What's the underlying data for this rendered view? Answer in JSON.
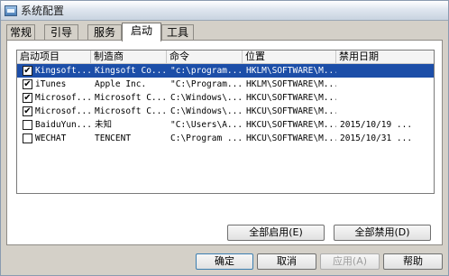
{
  "window": {
    "title": "系统配置"
  },
  "tabs": [
    {
      "label": "常规"
    },
    {
      "label": "引导"
    },
    {
      "label": "服务"
    },
    {
      "label": "启动"
    },
    {
      "label": "工具"
    }
  ],
  "active_tab": "启动",
  "columns": [
    {
      "label": "启动项目"
    },
    {
      "label": "制造商"
    },
    {
      "label": "命令"
    },
    {
      "label": "位置"
    },
    {
      "label": "禁用日期"
    }
  ],
  "rows": [
    {
      "checked": true,
      "selected": true,
      "item": "Kingsoft...",
      "maker": "Kingsoft Co...",
      "command": "\"c:\\program...",
      "location": "HKLM\\SOFTWARE\\M...",
      "date": ""
    },
    {
      "checked": true,
      "selected": false,
      "item": "iTunes",
      "maker": "Apple Inc.",
      "command": "\"C:\\Program...",
      "location": "HKLM\\SOFTWARE\\M...",
      "date": ""
    },
    {
      "checked": true,
      "selected": false,
      "item": "Microsof...",
      "maker": "Microsoft C...",
      "command": "C:\\Windows\\...",
      "location": "HKCU\\SOFTWARE\\M...",
      "date": ""
    },
    {
      "checked": true,
      "selected": false,
      "item": "Microsof...",
      "maker": "Microsoft C...",
      "command": "C:\\Windows\\...",
      "location": "HKCU\\SOFTWARE\\M...",
      "date": ""
    },
    {
      "checked": false,
      "selected": false,
      "item": "BaiduYun...",
      "maker": "未知",
      "command": "\"C:\\Users\\A...",
      "location": "HKCU\\SOFTWARE\\M...",
      "date": "2015/10/19 ..."
    },
    {
      "checked": false,
      "selected": false,
      "item": "WECHAT",
      "maker": "TENCENT",
      "command": "C:\\Program ...",
      "location": "HKCU\\SOFTWARE\\M...",
      "date": "2015/10/31 ..."
    }
  ],
  "panel_buttons": {
    "enable_all": "全部启用(E)",
    "disable_all": "全部禁用(D)"
  },
  "dialog_buttons": {
    "ok": "确定",
    "cancel": "取消",
    "apply": "应用(A)",
    "help": "帮助"
  },
  "colors": {
    "selection": "#1c4ea8",
    "title_gradient_top": "#ffffff"
  }
}
